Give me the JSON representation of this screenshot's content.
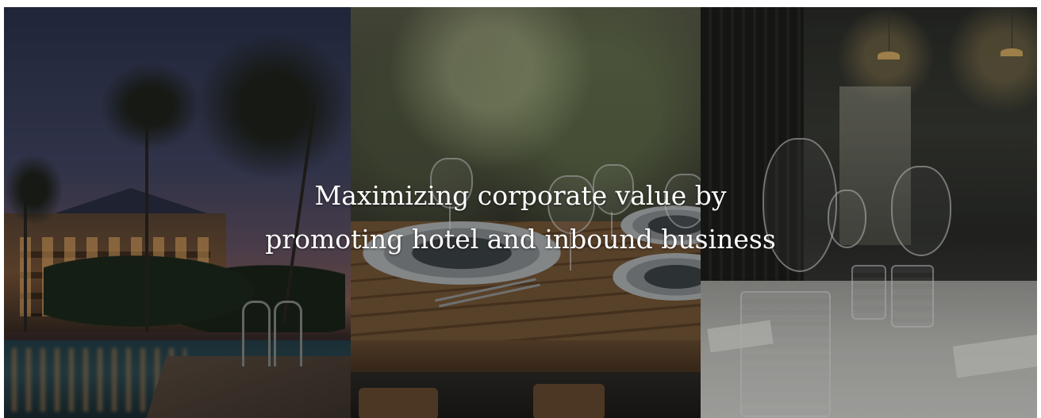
{
  "hero": {
    "headline_line1": "Maximizing corporate value by",
    "headline_line2": "promoting hotel and inbound business"
  },
  "colors": {
    "text": "#ffffff",
    "overlay": "rgba(0,0,0,0.28)"
  },
  "panels": [
    {
      "depicts": "resort hotel with palm trees and pool at dusk"
    },
    {
      "depicts": "wooden restaurant table with plates and wine glasses"
    },
    {
      "depicts": "dining hall table with wine glasses and tumblers"
    }
  ]
}
